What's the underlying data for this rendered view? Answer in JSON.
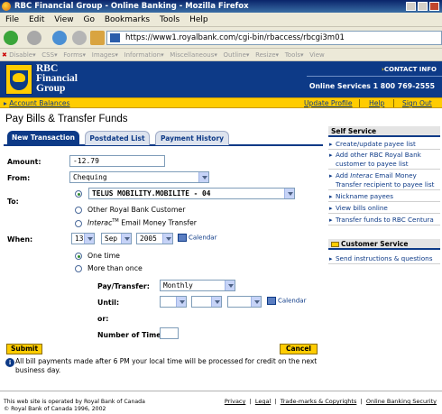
{
  "window": {
    "title": "RBC Financial Group - Online Banking - Mozilla Firefox"
  },
  "menu": [
    "File",
    "Edit",
    "View",
    "Go",
    "Bookmarks",
    "Tools",
    "Help"
  ],
  "browser": {
    "url": "https://www1.royalbank.com/cgi-bin/rbaccess/rbcgi3m01"
  },
  "devtoolbar": {
    "disable": "Disable",
    "items": [
      "CSS",
      "Forms",
      "Images",
      "Information",
      "Miscellaneous",
      "Outline",
      "Resize",
      "Tools",
      "View"
    ]
  },
  "header": {
    "brand_line1": "RBC",
    "brand_line2": "Financial",
    "brand_line3": "Group",
    "contact": "CONTACT INFO",
    "phone": "Online Services 1 800 769-2555"
  },
  "utility": {
    "account_balances": "Account Balances",
    "update_profile": "Update Profile",
    "help": "Help",
    "sign_out": "Sign Out"
  },
  "page": {
    "title": "Pay Bills & Transfer Funds",
    "tabs": [
      "New Transaction",
      "Postdated List",
      "Payment History"
    ],
    "amount_label": "Amount:",
    "amount_value": "-12.79",
    "from_label": "From:",
    "from_value": "Chequing",
    "to_label": "To:",
    "payee_value": "TELUS MOBILITY.MOBILITE - 04",
    "other_payee": "Other Royal Bank Customer",
    "interac_a": "Interac",
    "interac_tm": "TM",
    "interac_b": " Email Money Transfer",
    "when_label": "When:",
    "day": "13",
    "month": "Sep",
    "year": "2005",
    "calendar": "Calendar",
    "one_time": "One time",
    "more_than_once": "More than once",
    "pay_transfer_label": "Pay/Transfer:",
    "frequency": "Monthly",
    "until_label": "Until:",
    "or_label": "or:",
    "number_times_label": "Number of Times:",
    "submit": "Submit",
    "cancel": "Cancel",
    "note_icon": "i",
    "note": "All bill payments made after 6 PM your local time will be processed for credit on the next business day."
  },
  "sidebar": {
    "self_service": "Self Service",
    "items": [
      "Create/update payee list",
      "Add other RBC Royal Bank customer to payee list",
      "Add Interac Email Money Transfer recipient to payee list",
      "Nickname payees",
      "View bills online",
      "Transfer funds to RBC Centura"
    ],
    "customer_service": "Customer Service",
    "cs_items": [
      "Send instructions & questions"
    ]
  },
  "footer": {
    "line1": "This web site is operated by Royal Bank of Canada",
    "line2": "© Royal Bank of Canada 1996, 2002",
    "links": [
      "Privacy",
      "Legal",
      "Trade-marks & Copyrights",
      "Online Banking Security"
    ]
  }
}
